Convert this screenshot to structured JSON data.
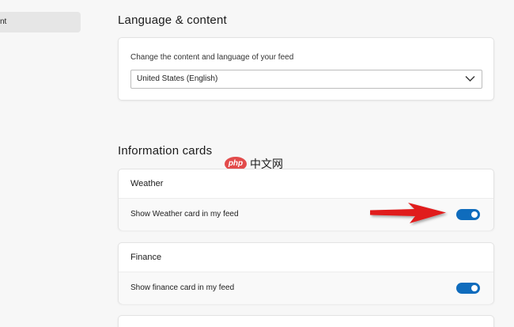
{
  "sidebar": {
    "selected_item_label": "nt"
  },
  "language_section": {
    "title": "Language & content",
    "description": "Change the content and language of your feed",
    "dropdown_value": "United States (English)"
  },
  "info_section": {
    "title": "Information cards",
    "cards": [
      {
        "title": "Weather",
        "toggle_label": "Show Weather card in my feed",
        "enabled": true
      },
      {
        "title": "Finance",
        "toggle_label": "Show finance card in my feed",
        "enabled": true
      }
    ]
  },
  "watermark": {
    "logo_text": "php",
    "text": "中文网"
  },
  "colors": {
    "toggle_on": "#0f6cbd",
    "arrow": "#e01b1b",
    "watermark": "#e24b4b"
  },
  "icons": {
    "dropdown": "chevron-down-icon",
    "annotation": "red-arrow-icon"
  }
}
